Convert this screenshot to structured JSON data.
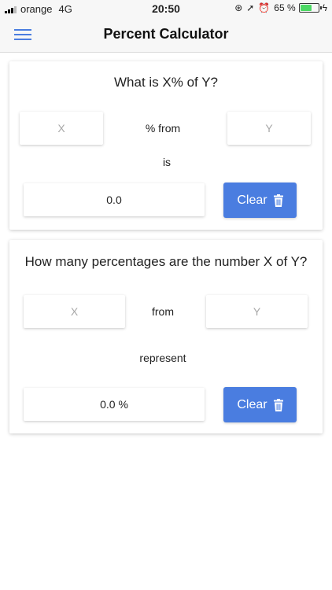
{
  "status_bar": {
    "carrier": "orange",
    "network": "4G",
    "time": "20:50",
    "battery_percent": "65 %",
    "battery_level": 0.65
  },
  "nav": {
    "title": "Percent Calculator"
  },
  "calc1": {
    "title": "What is X%  of Y?",
    "x_placeholder": "X",
    "middle_label": "% from",
    "y_placeholder": "Y",
    "is_label": "is",
    "result": "0.0",
    "clear_label": "Clear"
  },
  "calc2": {
    "title": "How many percentages are the number X of Y?",
    "x_placeholder": "X",
    "middle_label": "from",
    "y_placeholder": "Y",
    "represent_label": "represent",
    "result": "0.0 %",
    "clear_label": "Clear"
  },
  "colors": {
    "accent": "#4a7de0",
    "battery": "#4cd964"
  },
  "icons": [
    "signal-icon",
    "menu-icon",
    "trash-icon",
    "location-icon",
    "alarm-icon",
    "lock-rotation-icon",
    "charging-icon"
  ]
}
